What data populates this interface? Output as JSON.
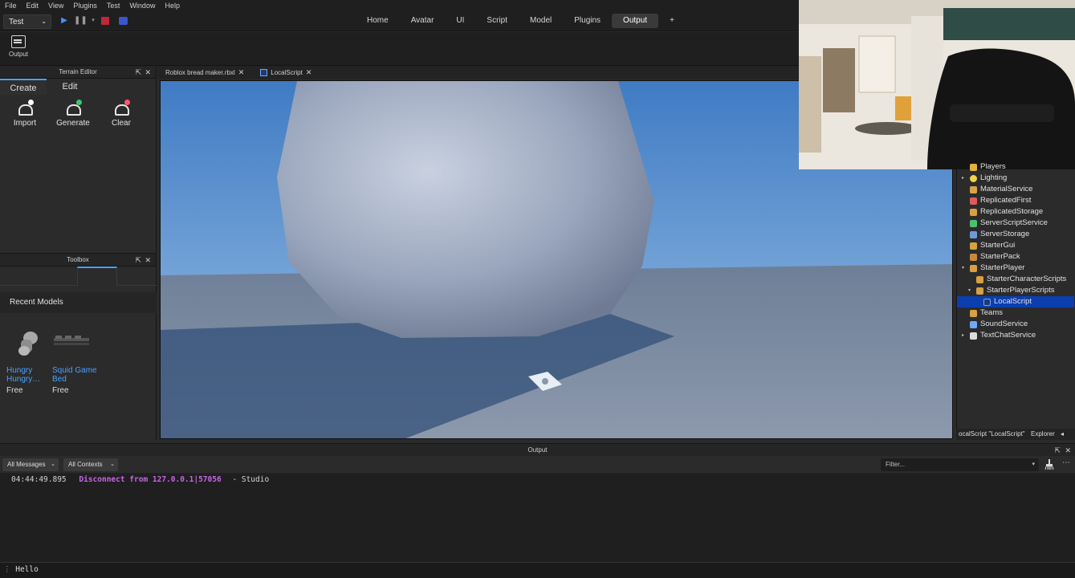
{
  "menubar": [
    "File",
    "Edit",
    "View",
    "Plugins",
    "Test",
    "Window",
    "Help"
  ],
  "toolbar": {
    "mode": "Test"
  },
  "ribbon_tabs": [
    {
      "label": "Home",
      "active": false
    },
    {
      "label": "Avatar",
      "active": false
    },
    {
      "label": "UI",
      "active": false
    },
    {
      "label": "Script",
      "active": false
    },
    {
      "label": "Model",
      "active": false
    },
    {
      "label": "Plugins",
      "active": false
    },
    {
      "label": "Output",
      "active": true
    },
    {
      "label": "+",
      "active": false
    }
  ],
  "ribbon": {
    "output_label": "Output"
  },
  "terrain": {
    "title": "Terrain Editor",
    "tabs": [
      {
        "label": "Create",
        "active": true
      },
      {
        "label": "Edit",
        "active": false
      }
    ],
    "tools": [
      {
        "label": "Import",
        "icon": "terrain-import-icon",
        "accent": "#ffffff"
      },
      {
        "label": "Generate",
        "icon": "terrain-generate-icon",
        "accent": "#3cc86e"
      },
      {
        "label": "Clear",
        "icon": "terrain-clear-icon",
        "accent": "#ff5a6a"
      }
    ]
  },
  "toolbox": {
    "title": "Toolbox",
    "recent_label": "Recent Models",
    "models": [
      {
        "name_line1": "Hungry",
        "name_line2": "Hungry…",
        "price": "Free"
      },
      {
        "name_line1": "Squid Game",
        "name_line2": "Bed",
        "price": "Free"
      }
    ]
  },
  "doc_tabs": [
    {
      "label": "Roblox bread maker.rbxl"
    },
    {
      "label": "LocalScript"
    }
  ],
  "explorer": {
    "items": [
      {
        "label": "Players",
        "depth": 0,
        "arrow": "",
        "icon_color": "#e0b040",
        "partial": true
      },
      {
        "label": "Lighting",
        "depth": 0,
        "arrow": "▸",
        "icon_color": "#f2d24a"
      },
      {
        "label": "MaterialService",
        "depth": 0,
        "arrow": "",
        "icon_color": "#d6a54a"
      },
      {
        "label": "ReplicatedFirst",
        "depth": 0,
        "arrow": "",
        "icon_color": "#e05a5a"
      },
      {
        "label": "ReplicatedStorage",
        "depth": 0,
        "arrow": "",
        "icon_color": "#d8a040"
      },
      {
        "label": "ServerScriptService",
        "depth": 0,
        "arrow": "",
        "icon_color": "#4cc070"
      },
      {
        "label": "ServerStorage",
        "depth": 0,
        "arrow": "",
        "icon_color": "#6a9ad8"
      },
      {
        "label": "StarterGui",
        "depth": 0,
        "arrow": "",
        "icon_color": "#d8a040"
      },
      {
        "label": "StarterPack",
        "depth": 0,
        "arrow": "",
        "icon_color": "#c88a3a"
      },
      {
        "label": "StarterPlayer",
        "depth": 0,
        "arrow": "▾",
        "icon_color": "#d8a040"
      },
      {
        "label": "StarterCharacterScripts",
        "depth": 1,
        "arrow": "",
        "icon_color": "#d8a040"
      },
      {
        "label": "StarterPlayerScripts",
        "depth": 1,
        "arrow": "▾",
        "icon_color": "#d8a040"
      },
      {
        "label": "LocalScript",
        "depth": 2,
        "arrow": "",
        "icon_color": "#6fa8ff",
        "selected": true
      },
      {
        "label": "Teams",
        "depth": 0,
        "arrow": "",
        "icon_color": "#d8a040"
      },
      {
        "label": "SoundService",
        "depth": 0,
        "arrow": "",
        "icon_color": "#6fa8ff"
      },
      {
        "label": "TextChatService",
        "depth": 0,
        "arrow": "▸",
        "icon_color": "#dcdcdc"
      }
    ],
    "status": "ocalScript \"LocalScript\"",
    "tab_label": "Explorer"
  },
  "output": {
    "title": "Output",
    "filter_messages": "All Messages",
    "filter_contexts": "All Contexts",
    "filter_placeholder": "Filter...",
    "lines": [
      {
        "time": "04:44:49.895",
        "message": "Disconnect from 127.0.0.1|57056",
        "source": "-  Studio"
      }
    ]
  },
  "command_bar": {
    "text": "Hello"
  }
}
